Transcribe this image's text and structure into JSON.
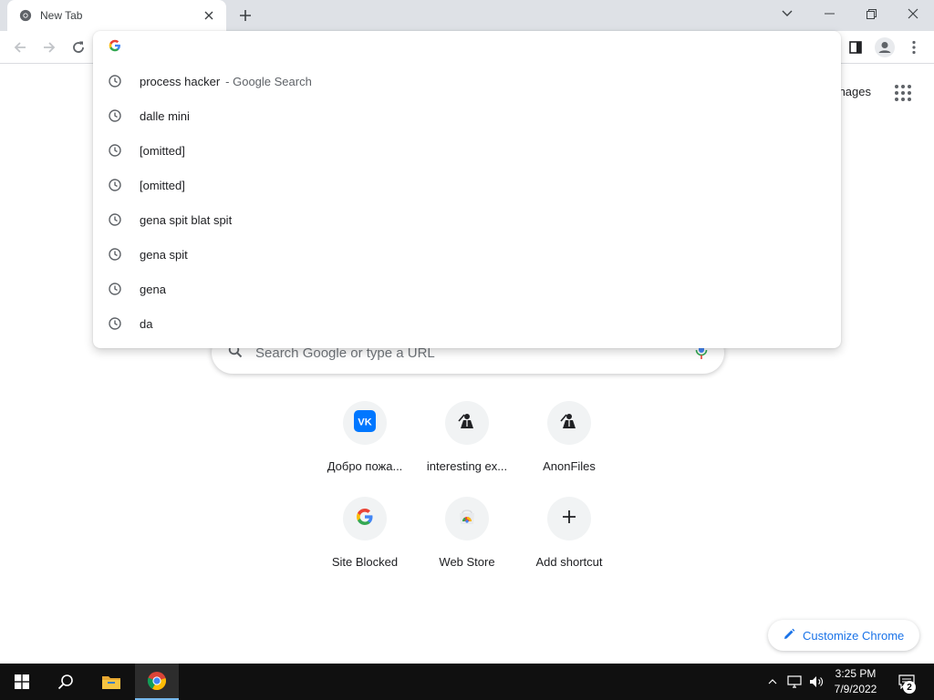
{
  "browser": {
    "tab": {
      "title": "New Tab"
    },
    "toolbar": {
      "omnibox_value": ""
    }
  },
  "omnibox": {
    "suggestions": [
      {
        "text": "process hacker",
        "suffix": "- Google Search"
      },
      {
        "text": "dalle mini",
        "suffix": ""
      },
      {
        "text": "[omitted]",
        "suffix": ""
      },
      {
        "text": "[omitted]",
        "suffix": ""
      },
      {
        "text": "gena spit blat spit",
        "suffix": ""
      },
      {
        "text": "gena spit",
        "suffix": ""
      },
      {
        "text": "gena",
        "suffix": ""
      },
      {
        "text": "da",
        "suffix": ""
      }
    ]
  },
  "ntp": {
    "header_link": "nages",
    "search_placeholder": "Search Google or type a URL",
    "shortcuts": [
      {
        "label": "Добро пожа...",
        "icon": "vk-icon"
      },
      {
        "label": "interesting ex...",
        "icon": "anon-site-icon"
      },
      {
        "label": "AnonFiles",
        "icon": "anon-site-icon"
      },
      {
        "label": "Site Blocked",
        "icon": "google-g-icon"
      },
      {
        "label": "Web Store",
        "icon": "chrome-web-store-icon"
      },
      {
        "label": "Add shortcut",
        "icon": "plus-icon"
      }
    ],
    "customize_label": "Customize Chrome"
  },
  "taskbar": {
    "time": "3:25 PM",
    "date": "7/9/2022",
    "notification_count": "2"
  },
  "colors": {
    "tabstrip": "#dee1e6",
    "accent": "#1a73e8",
    "taskbar": "#101010"
  }
}
